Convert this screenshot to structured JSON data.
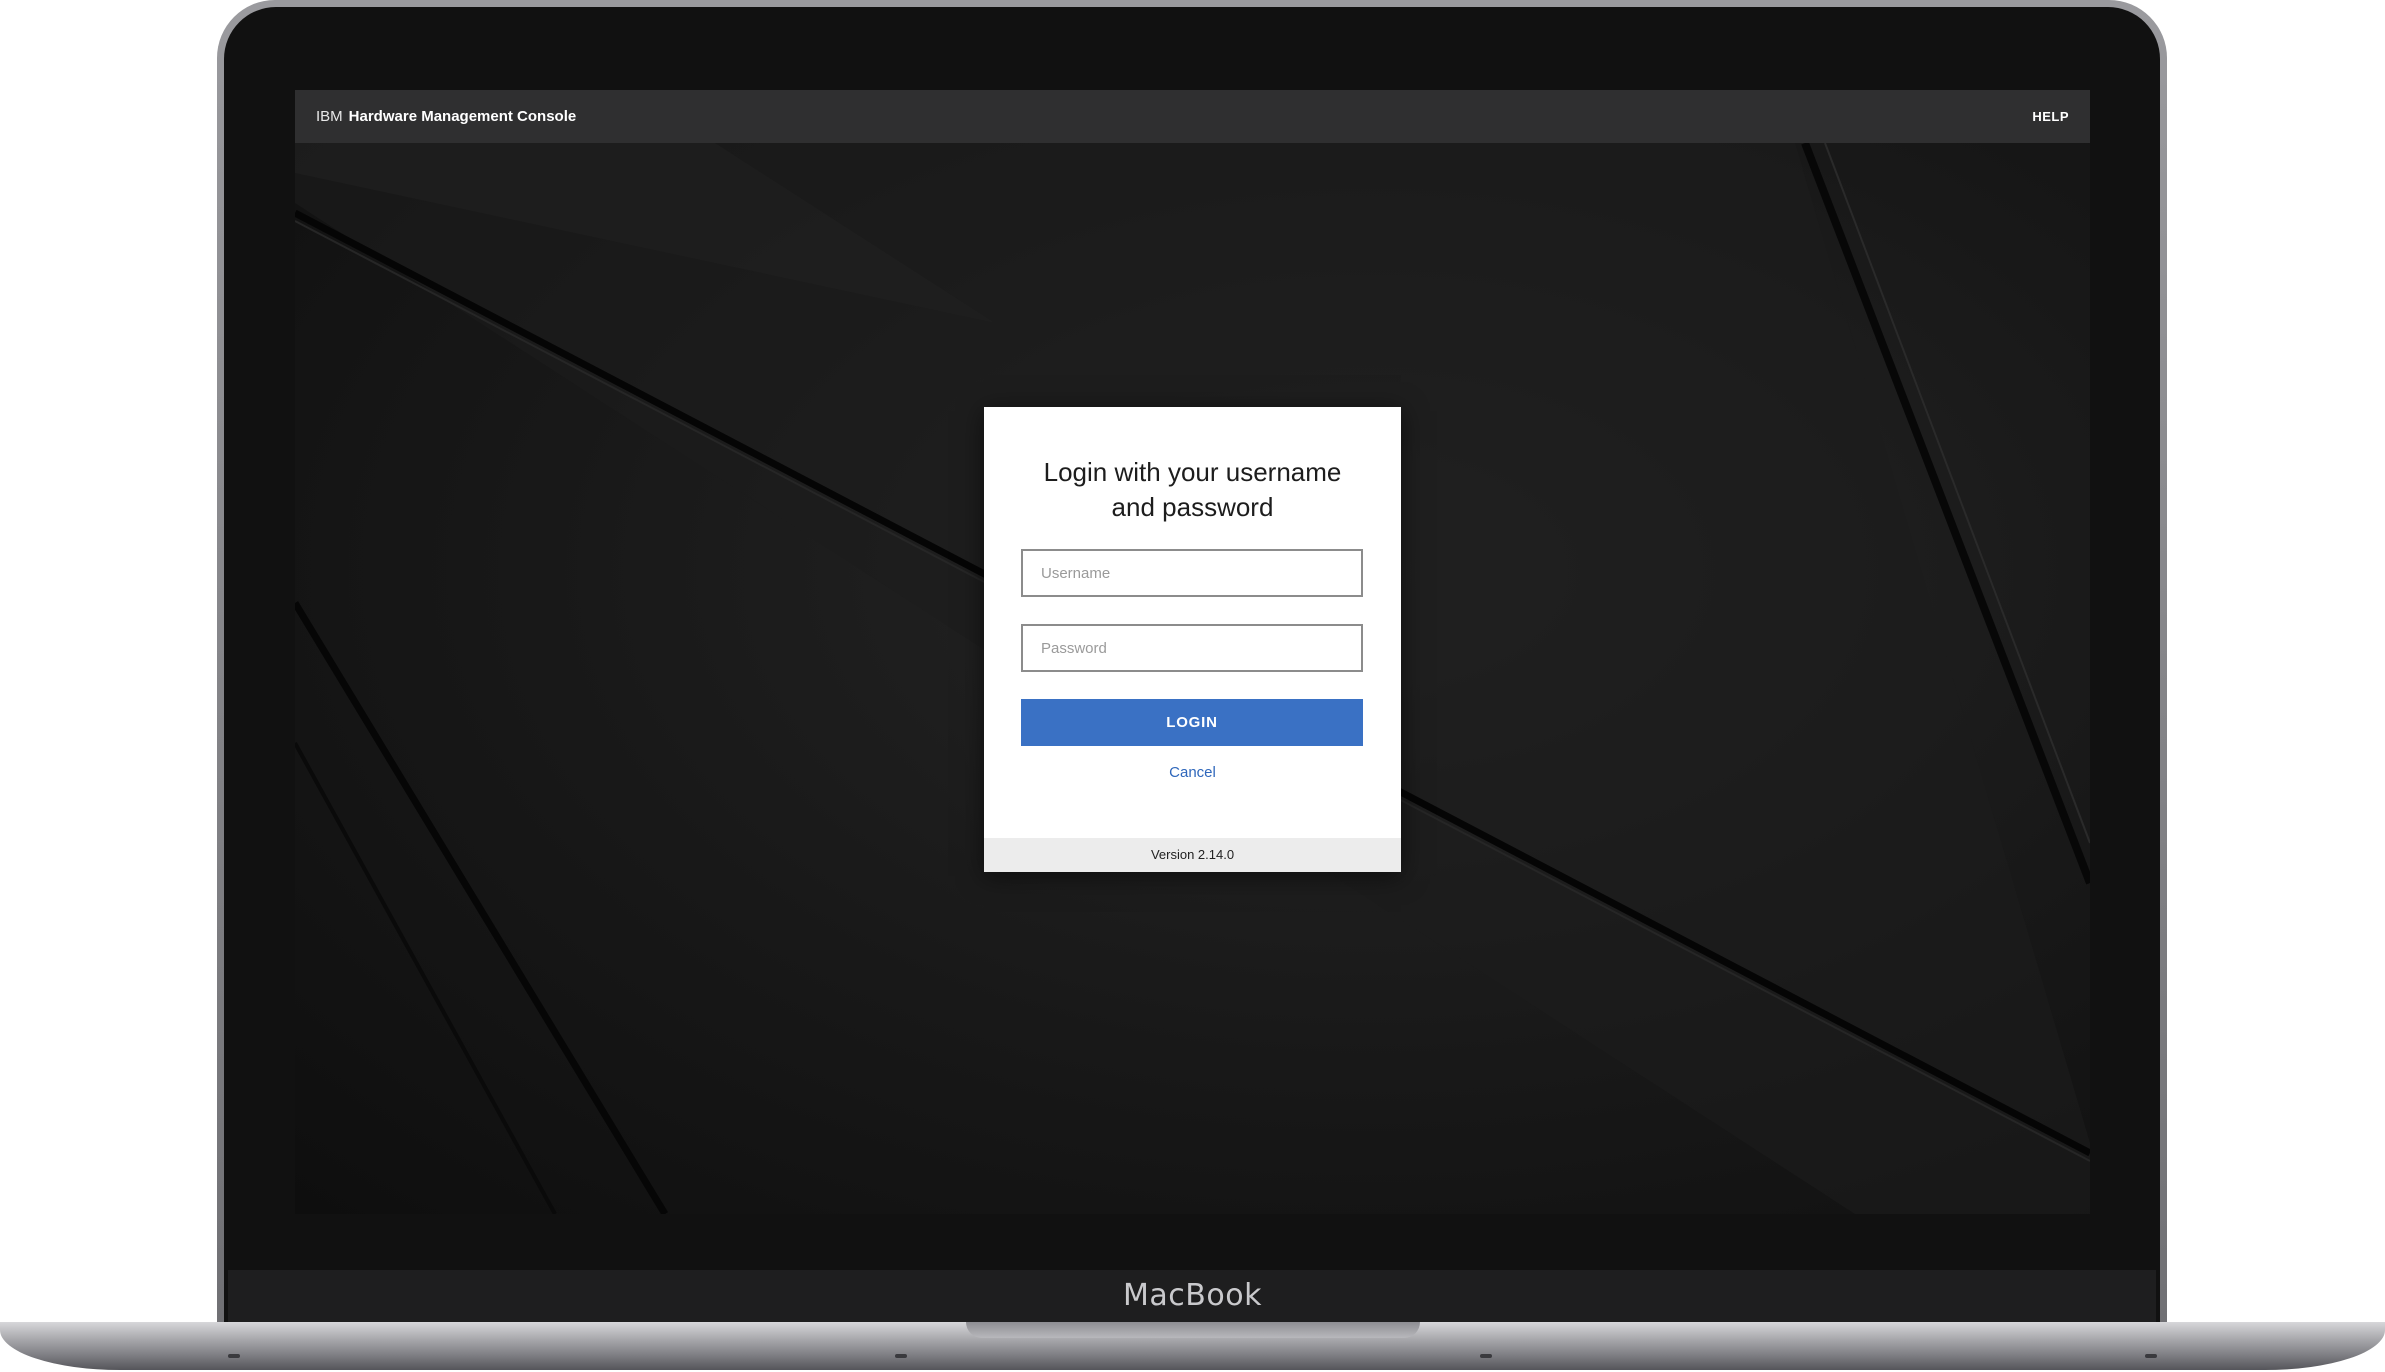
{
  "device": {
    "brand_label": "MacBook"
  },
  "header": {
    "brand": "IBM",
    "app_name": "Hardware Management Console",
    "help_label": "HELP"
  },
  "login": {
    "title_line1": "Login with your username",
    "title_line2": "and password",
    "username_placeholder": "Username",
    "username_value": "",
    "password_placeholder": "Password",
    "password_value": "",
    "login_label": "LOGIN",
    "cancel_label": "Cancel",
    "version": "Version 2.14.0"
  },
  "colors": {
    "topbar": "#2f2f30",
    "primary_button": "#3a71c4",
    "link": "#2f67bb",
    "footer": "#ececec"
  }
}
